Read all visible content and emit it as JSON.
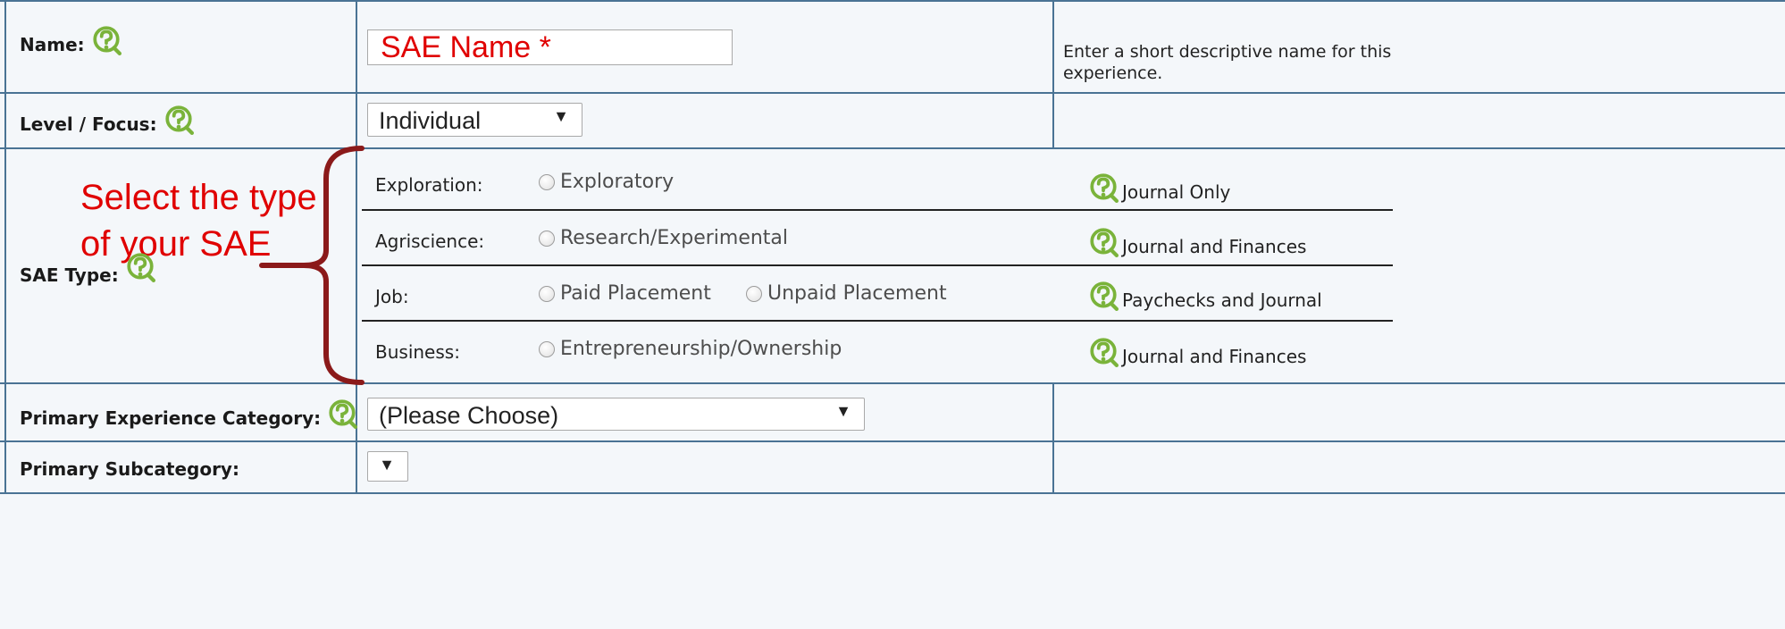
{
  "form": {
    "name": {
      "label": "Name:",
      "input_value": "SAE Name *",
      "description": "Enter a short descriptive name for this experience."
    },
    "level_focus": {
      "label": "Level / Focus:",
      "selected": "Individual"
    },
    "sae_type": {
      "label": "SAE Type:",
      "annotation": "Select the type of your SAE",
      "rows": [
        {
          "category": "Exploration:",
          "options": [
            "Exploratory"
          ],
          "note": "Journal Only"
        },
        {
          "category": "Agriscience:",
          "options": [
            "Research/Experimental"
          ],
          "note": "Journal and Finances"
        },
        {
          "category": "Job:",
          "options": [
            "Paid Placement",
            "Unpaid Placement"
          ],
          "note": "Paychecks and Journal"
        },
        {
          "category": "Business:",
          "options": [
            "Entrepreneurship/Ownership"
          ],
          "note": "Journal and Finances"
        }
      ]
    },
    "primary_category": {
      "label": "Primary Experience Category:",
      "selected": "(Please Choose)"
    },
    "primary_subcategory": {
      "label": "Primary Subcategory:",
      "selected": ""
    }
  },
  "colors": {
    "grid_line": "#4a7394",
    "annotation": "#e00000",
    "brace": "#8b1a1a",
    "help_icon": "#7ab33a"
  },
  "icons": {
    "help": "help-question-icon",
    "dropdown": "chevron-down-icon"
  }
}
